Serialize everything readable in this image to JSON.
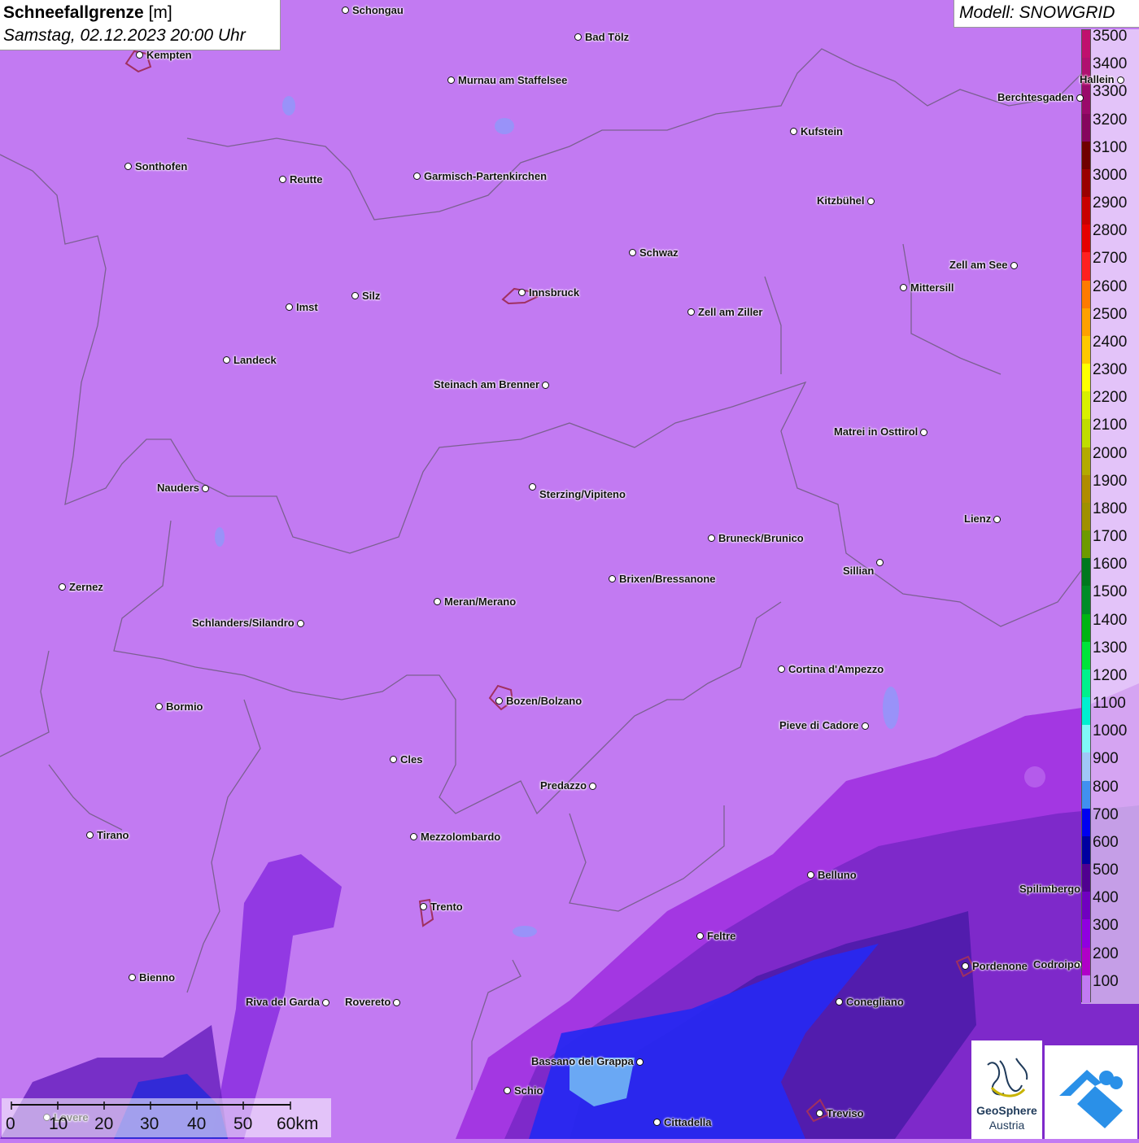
{
  "title": {
    "main": "Schneefallgrenze",
    "unit": "[m]",
    "datetime": "Samstag, 02.12.2023 20:00 Uhr"
  },
  "model": "Modell: SNOWGRID",
  "legend": {
    "labels": [
      "3500",
      "3400",
      "3300",
      "3200",
      "3100",
      "3000",
      "2900",
      "2800",
      "2700",
      "2600",
      "2500",
      "2400",
      "2300",
      "2200",
      "2100",
      "2000",
      "1900",
      "1800",
      "1700",
      "1600",
      "1500",
      "1400",
      "1300",
      "1200",
      "1100",
      "1000",
      "900",
      "800",
      "700",
      "600",
      "500",
      "400",
      "300",
      "200",
      "100"
    ],
    "colors": [
      "#c0106e",
      "#b01070",
      "#9a0a6a",
      "#86065e",
      "#700000",
      "#9a0000",
      "#c80000",
      "#e60000",
      "#ff2020",
      "#ff7a00",
      "#ffa000",
      "#ffc800",
      "#ffff00",
      "#d8f000",
      "#c0dc00",
      "#b4aa00",
      "#b08c00",
      "#a09000",
      "#6e9a00",
      "#00781e",
      "#008c28",
      "#00b414",
      "#00e43a",
      "#00f08c",
      "#00f0d0",
      "#80f8f8",
      "#a0c8f8",
      "#4090f0",
      "#0000f0",
      "#0000a0",
      "#500090",
      "#7000c0",
      "#9000e0",
      "#b000c8",
      "#c27af2"
    ]
  },
  "cities": [
    {
      "name": "Schongau"
    },
    {
      "name": "Bad Tölz"
    },
    {
      "name": "Kempten"
    },
    {
      "name": "Murnau am Staffelsee"
    },
    {
      "name": "Berchtesgaden"
    },
    {
      "name": "Kufstein"
    },
    {
      "name": "Sonthofen"
    },
    {
      "name": "Reutte"
    },
    {
      "name": "Garmisch-Partenkirchen"
    },
    {
      "name": "Kitzbühel"
    },
    {
      "name": "Schwaz"
    },
    {
      "name": "Zell am See"
    },
    {
      "name": "Innsbruck"
    },
    {
      "name": "Mittersill"
    },
    {
      "name": "Imst"
    },
    {
      "name": "Silz"
    },
    {
      "name": "Zell am Ziller"
    },
    {
      "name": "Landeck"
    },
    {
      "name": "Steinach am Brenner"
    },
    {
      "name": "Matrei in Osttirol"
    },
    {
      "name": "Nauders"
    },
    {
      "name": "Sterzing/Vipiteno"
    },
    {
      "name": "Lienz"
    },
    {
      "name": "Bruneck/Brunico"
    },
    {
      "name": "Sillian"
    },
    {
      "name": "Zernez"
    },
    {
      "name": "Brixen/Bressanone"
    },
    {
      "name": "Meran/Merano"
    },
    {
      "name": "Schlanders/Silandro"
    },
    {
      "name": "Cortina d'Ampezzo"
    },
    {
      "name": "Bozen/Bolzano"
    },
    {
      "name": "Bormio"
    },
    {
      "name": "Pieve di Cadore"
    },
    {
      "name": "Cles"
    },
    {
      "name": "Predazzo"
    },
    {
      "name": "Tirano"
    },
    {
      "name": "Mezzolombardo"
    },
    {
      "name": "Belluno"
    },
    {
      "name": "Spilimbergo"
    },
    {
      "name": "Trento"
    },
    {
      "name": "Feltre"
    },
    {
      "name": "Pordenone"
    },
    {
      "name": "Bienno"
    },
    {
      "name": "Riva del Garda"
    },
    {
      "name": "Rovereto"
    },
    {
      "name": "Conegliano"
    },
    {
      "name": "Bassano del Grappa"
    },
    {
      "name": "Schio"
    },
    {
      "name": "Treviso"
    },
    {
      "name": "Cittadella"
    },
    {
      "name": "Hallein"
    },
    {
      "name": "Lovere"
    },
    {
      "name": "Codroipo"
    }
  ],
  "scale": {
    "labels": [
      "0",
      "10",
      "20",
      "30",
      "40",
      "50",
      "60km"
    ]
  },
  "logo": {
    "name": "GeoSphere",
    "sub": "Austria"
  }
}
